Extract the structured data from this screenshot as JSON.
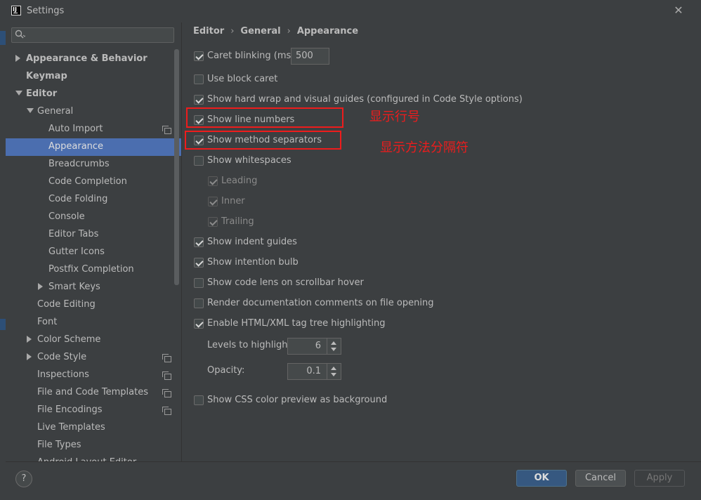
{
  "window": {
    "title": "Settings"
  },
  "search": {
    "placeholder": ""
  },
  "sidebar": {
    "items": [
      {
        "label": "Appearance & Behavior",
        "bold": true
      },
      {
        "label": "Keymap",
        "bold": true
      },
      {
        "label": "Editor",
        "bold": true
      },
      {
        "label": "General"
      },
      {
        "label": "Auto Import"
      },
      {
        "label": "Appearance",
        "selected": true
      },
      {
        "label": "Breadcrumbs"
      },
      {
        "label": "Code Completion"
      },
      {
        "label": "Code Folding"
      },
      {
        "label": "Console"
      },
      {
        "label": "Editor Tabs"
      },
      {
        "label": "Gutter Icons"
      },
      {
        "label": "Postfix Completion"
      },
      {
        "label": "Smart Keys"
      },
      {
        "label": "Code Editing"
      },
      {
        "label": "Font"
      },
      {
        "label": "Color Scheme"
      },
      {
        "label": "Code Style"
      },
      {
        "label": "Inspections"
      },
      {
        "label": "File and Code Templates"
      },
      {
        "label": "File Encodings"
      },
      {
        "label": "Live Templates"
      },
      {
        "label": "File Types"
      },
      {
        "label": "Android Layout Editor"
      }
    ]
  },
  "breadcrumb": {
    "items": [
      "Editor",
      "General",
      "Appearance"
    ],
    "separator": "›"
  },
  "options": {
    "caret_blinking": {
      "label": "Caret blinking (ms):",
      "checked": true,
      "value": "500"
    },
    "block_caret": {
      "label": "Use block caret",
      "checked": false
    },
    "hard_wrap": {
      "label": "Show hard wrap and visual guides (configured in Code Style options)",
      "checked": true
    },
    "line_numbers": {
      "label": "Show line numbers",
      "checked": true
    },
    "method_separators": {
      "label": "Show method separators",
      "checked": true
    },
    "whitespaces": {
      "label": "Show whitespaces",
      "checked": false
    },
    "leading": {
      "label": "Leading",
      "checked": true
    },
    "inner": {
      "label": "Inner",
      "checked": true
    },
    "trailing": {
      "label": "Trailing",
      "checked": true
    },
    "indent_guides": {
      "label": "Show indent guides",
      "checked": true
    },
    "intention_bulb": {
      "label": "Show intention bulb",
      "checked": true
    },
    "code_lens": {
      "label": "Show code lens on scrollbar hover",
      "checked": false
    },
    "render_docs": {
      "label": "Render documentation comments on file opening",
      "checked": false
    },
    "tag_tree": {
      "label": "Enable HTML/XML tag tree highlighting",
      "checked": true
    },
    "levels": {
      "label": "Levels to highlight:",
      "value": "6"
    },
    "opacity": {
      "label": "Opacity:",
      "value": "0.1"
    },
    "css_color": {
      "label": "Show CSS color preview as background",
      "checked": false
    }
  },
  "annotations": {
    "line_numbers_note": "显示行号",
    "method_separators_note": "显示方法分隔符",
    "color": "#ee1c1c"
  },
  "footer": {
    "help_label": "?",
    "ok_label": "OK",
    "cancel_label": "Cancel",
    "apply_label": "Apply"
  },
  "colors": {
    "background": "#3c3f41",
    "selection": "#4b6eaf",
    "ok_button": "#365880"
  }
}
